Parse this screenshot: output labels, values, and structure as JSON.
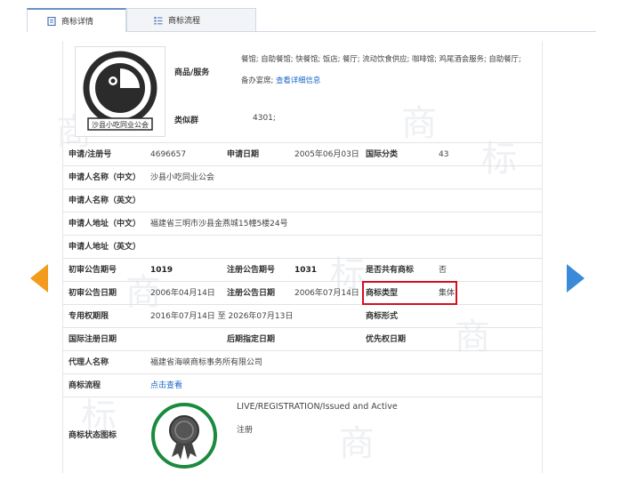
{
  "tabs": [
    {
      "label": "商标详情"
    },
    {
      "label": "商标流程"
    }
  ],
  "logo": {
    "caption": "沙县小吃同业公会"
  },
  "product_services": {
    "label": "商品/服务",
    "line1": "餐馆; 自助餐馆; 快餐馆; 饭店; 餐厅; 流动饮食供应; 咖啡馆; 鸡尾酒会服务; 自助餐厅;",
    "line2": "备办宴席;",
    "link": "查看详细信息"
  },
  "similar_group": {
    "label": "类似群",
    "value": "4301;"
  },
  "fields": {
    "reg_no_label": "申请/注册号",
    "reg_no": "4696657",
    "apply_date_label": "申请日期",
    "apply_date": "2005年06月03日",
    "intl_class_label": "国际分类",
    "intl_class": "43",
    "applicant_cn_label": "申请人名称（中文）",
    "applicant_cn": "沙县小吃同业公会",
    "applicant_en_label": "申请人名称（英文）",
    "applicant_en": "",
    "address_cn_label": "申请人地址（中文）",
    "address_cn": "福建省三明市沙县金燕城15幢5楼24号",
    "address_en_label": "申请人地址（英文）",
    "address_en": "",
    "prelim_issue_label": "初审公告期号",
    "prelim_issue": "1019",
    "reg_issue_label": "注册公告期号",
    "reg_issue": "1031",
    "shared_label": "是否共有商标",
    "shared": "否",
    "prelim_date_label": "初审公告日期",
    "prelim_date": "2006年04月14日",
    "reg_date_label": "注册公告日期",
    "reg_date": "2006年07月14日",
    "tm_type_label": "商标类型",
    "tm_type": "集体",
    "exclusive_label": "专用权期限",
    "exclusive": "2016年07月14日 至 2026年07月13日",
    "tm_form_label": "商标形式",
    "tm_form": "",
    "intl_reg_label": "国际注册日期",
    "intl_reg": "",
    "later_date_label": "后期指定日期",
    "later_date": "",
    "priority_label": "优先权日期",
    "priority": "",
    "agent_label": "代理人名称",
    "agent": "福建省海峡商标事务所有限公司",
    "process_label": "商标流程",
    "process_link": "点击查看",
    "status_label": "商标状态图标",
    "status_en": "LIVE/REGISTRATION/Issued and Active",
    "status_cn": "注册"
  },
  "colors": {
    "accent": "#6b8fc8",
    "highlight": "#d40f22",
    "link": "#1a67c9",
    "arrow_left": "#f29b1d",
    "arrow_right": "#3b8ad9",
    "badge_ring": "#1a8a3e"
  }
}
